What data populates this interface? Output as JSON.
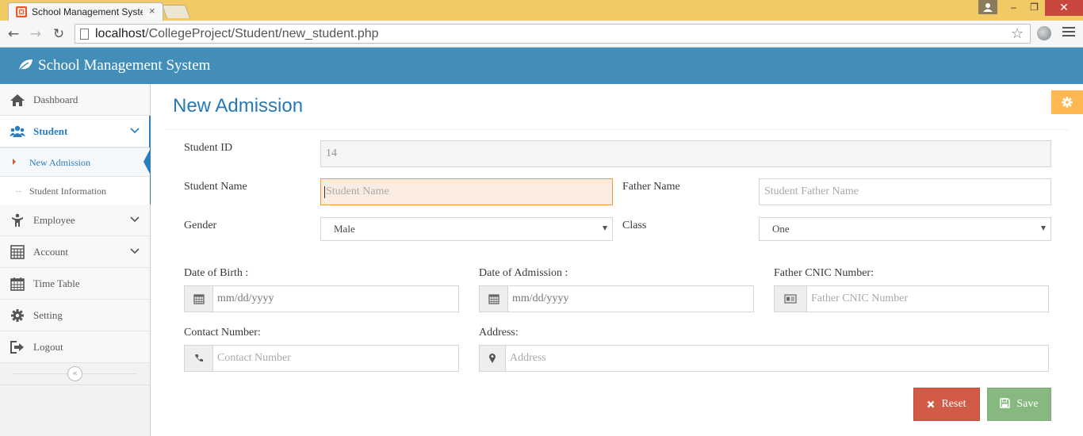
{
  "browser": {
    "tab_title": "School Management Syste",
    "tab_close": "×",
    "url_host": "localhost",
    "url_path": "/CollegeProject/Student/new_student.php",
    "window_controls": {
      "minimize": "‒",
      "maximize": "❐",
      "close": "✕"
    },
    "nav": {
      "back": "←",
      "forward": "→",
      "reload": "↻",
      "star": "☆"
    }
  },
  "app": {
    "brand": "School Management System",
    "header_color": "#438eb9"
  },
  "sidebar": {
    "items": [
      {
        "label": "Dashboard",
        "icon": "home-icon"
      },
      {
        "label": "Student",
        "icon": "users-icon",
        "active": true,
        "expanded": true,
        "children": [
          {
            "label": "New Admission",
            "active": true
          },
          {
            "label": "Student Information"
          }
        ]
      },
      {
        "label": "Employee",
        "icon": "person-icon",
        "has_children": true
      },
      {
        "label": "Account",
        "icon": "calculator-icon",
        "has_children": true
      },
      {
        "label": "Time Table",
        "icon": "calendar-icon"
      },
      {
        "label": "Setting",
        "icon": "gear-icon"
      },
      {
        "label": "Logout",
        "icon": "logout-icon"
      }
    ],
    "collapse_glyph": "«"
  },
  "page": {
    "title": "New Admission"
  },
  "form": {
    "student_id": {
      "label": "Student ID",
      "value": "14"
    },
    "student_name": {
      "label": "Student Name",
      "placeholder": "Student Name"
    },
    "father_name": {
      "label": "Father Name",
      "placeholder": "Student Father Name"
    },
    "gender": {
      "label": "Gender",
      "value": "Male"
    },
    "class": {
      "label": "Class",
      "value": "One"
    },
    "dob": {
      "label": "Date of Birth :",
      "placeholder": "mm/dd/yyyy"
    },
    "doa": {
      "label": "Date of Admission :",
      "placeholder": "mm/dd/yyyy"
    },
    "cnic": {
      "label": "Father CNIC Number:",
      "placeholder": "Father CNIC Number"
    },
    "contact": {
      "label": "Contact Number:",
      "placeholder": "Contact Number"
    },
    "address": {
      "label": "Address:",
      "placeholder": "Address"
    }
  },
  "buttons": {
    "reset": "Reset",
    "save": "Save",
    "reset_color": "#d15b47",
    "save_color": "#87b87f"
  }
}
